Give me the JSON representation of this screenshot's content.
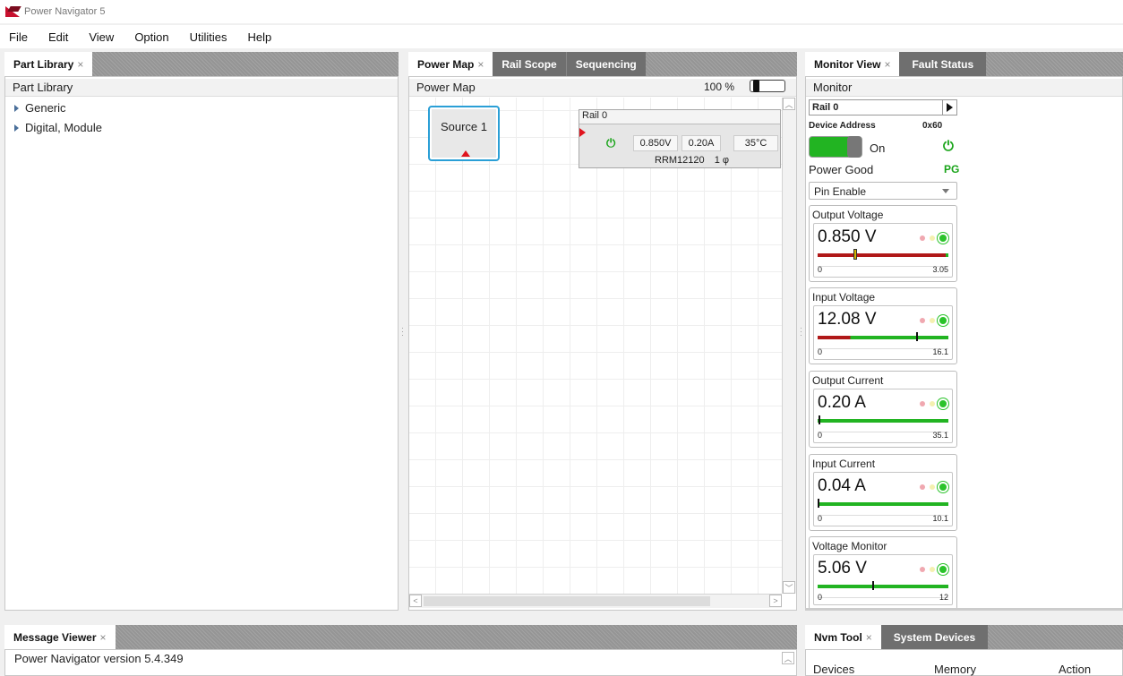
{
  "app": {
    "title": "Power Navigator 5"
  },
  "menu": [
    "File",
    "Edit",
    "View",
    "Option",
    "Utilities",
    "Help"
  ],
  "part_library": {
    "tab": "Part Library",
    "header": "Part Library",
    "items": [
      "Generic",
      "Digital, Module"
    ]
  },
  "center_tabs": [
    "Power Map",
    "Rail Scope",
    "Sequencing"
  ],
  "power_map": {
    "header": "Power Map",
    "zoom": "100 %",
    "source_label": "Source 1",
    "rail": {
      "title": "Rail 0",
      "voltage": "0.850V",
      "current": "0.20A",
      "temperature": "35°C",
      "part": "RRM12120",
      "phase": "1 φ"
    }
  },
  "right_tabs": [
    "Monitor View",
    "Fault Status"
  ],
  "monitor": {
    "header": "Monitor",
    "rail_name": "Rail 0",
    "device_address_label": "Device Address",
    "device_address": "0x60",
    "on_label": "On",
    "power_good_label": "Power Good",
    "power_good_value": "PG",
    "enable_select": "Pin Enable",
    "cards": [
      {
        "title": "Output Voltage",
        "value": "0.850 V",
        "min": "0",
        "max": "3.05",
        "level": 0.28,
        "red_split": 0.25,
        "bar_style": "red-with-green-tail"
      },
      {
        "title": "Input Voltage",
        "value": "12.08 V",
        "min": "0",
        "max": "16.1",
        "level": 0.75,
        "red_split": 0.25,
        "bar_style": "red-green"
      },
      {
        "title": "Output Current",
        "value": "0.20 A",
        "min": "0",
        "max": "35.1",
        "level": 0.01,
        "bar_style": "green"
      },
      {
        "title": "Input Current",
        "value": "0.04 A",
        "min": "0",
        "max": "10.1",
        "level": 0.0,
        "bar_style": "green"
      },
      {
        "title": "Voltage Monitor",
        "value": "5.06 V",
        "min": "0",
        "max": "12",
        "level": 0.42,
        "bar_style": "green"
      }
    ],
    "colors": {
      "red": "#b01818",
      "green": "#22b422"
    }
  },
  "message_viewer": {
    "tab": "Message Viewer",
    "lines": [
      "Power Navigator version 5.4.349"
    ]
  },
  "bottom_right_tabs": [
    "Nvm Tool",
    "System Devices"
  ],
  "nvm_columns": [
    "Devices",
    "Memory",
    "Action"
  ]
}
